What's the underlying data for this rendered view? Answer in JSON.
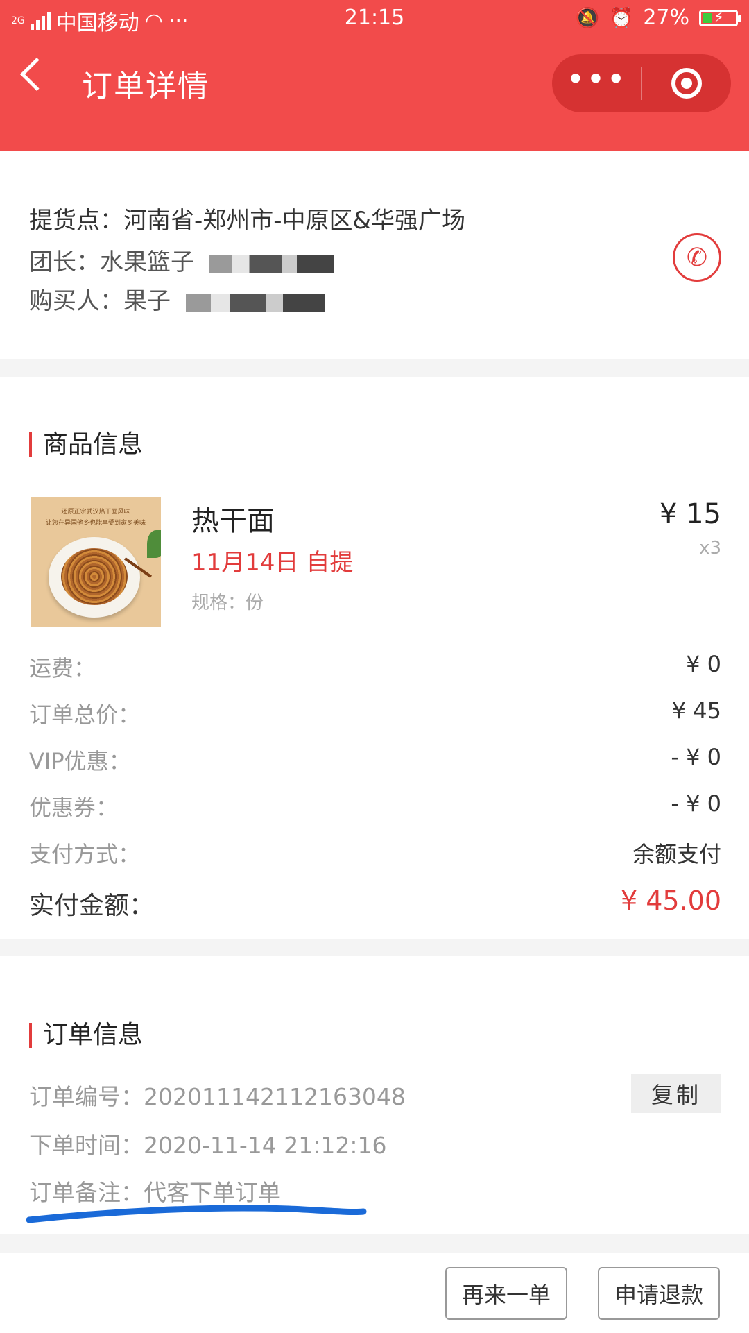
{
  "status_bar": {
    "network": "2G",
    "carrier": "中国移动",
    "dots": "···",
    "time": "21:15",
    "battery": "27%"
  },
  "nav": {
    "title": "订单详情",
    "more_label": "•••"
  },
  "pickup": {
    "point_label": "提货点：",
    "point_value": "河南省-郑州市-中原区&华强广场",
    "leader_label": "团长：",
    "leader_value": "水果篮子",
    "buyer_label": "购买人：",
    "buyer_value": "果子"
  },
  "goods": {
    "section_title": "商品信息",
    "item": {
      "thumb_caption_1": "还原正宗武汉热干面风味",
      "thumb_caption_2": "让您在异国他乡也能享受到家乡美味",
      "name": "热干面",
      "pickup_date": "11月14日 自提",
      "spec": "规格：份",
      "price": "¥ 15",
      "qty": "x3"
    },
    "rows": [
      {
        "label": "运费：",
        "value": "¥ 0"
      },
      {
        "label": "订单总价：",
        "value": "¥ 45"
      },
      {
        "label": "VIP优惠：",
        "value": "- ¥ 0"
      },
      {
        "label": "优惠券：",
        "value": "- ¥ 0"
      },
      {
        "label": "支付方式：",
        "value": "余额支付"
      }
    ],
    "total": {
      "label": "实付金额：",
      "value": "¥ 45.00"
    }
  },
  "order_info": {
    "section_title": "订单信息",
    "number_label": "订单编号：",
    "number_value": "202011142112163048",
    "copy_label": "复制",
    "time_label": "下单时间：",
    "time_value": "2020-11-14 21:12:16",
    "note_label": "订单备注：",
    "note_value": "代客下单订单"
  },
  "actions": {
    "reorder_label": "再来一单",
    "refund_label": "申请退款"
  },
  "colors": {
    "header_red": "#f24b4b",
    "accent_red": "#e23c3c",
    "ink_blue": "#1a6ad8"
  }
}
